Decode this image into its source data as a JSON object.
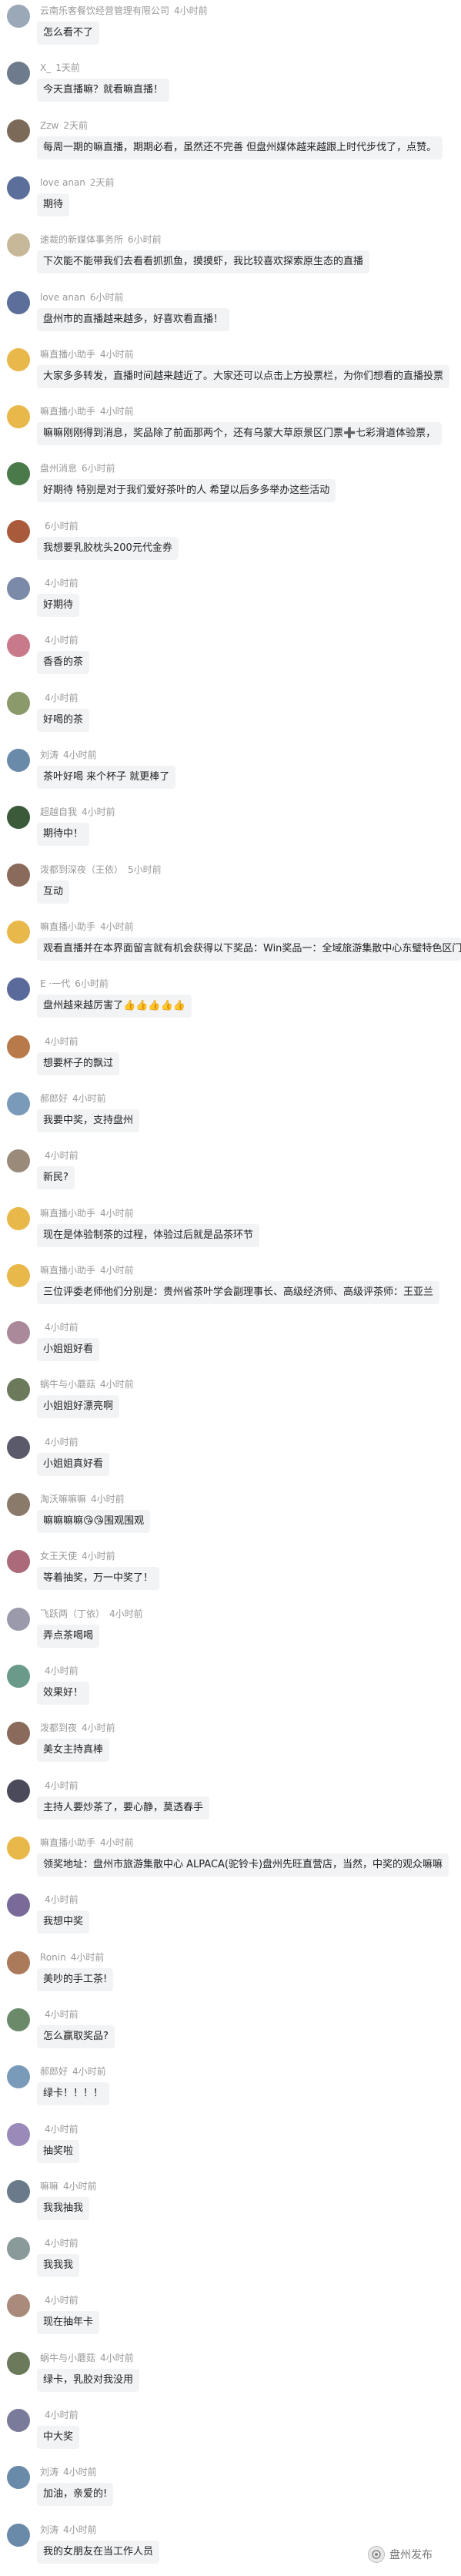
{
  "watermark": "盘州发布",
  "comments": [
    {
      "user": "云南乐客餐饮经营管理有限公司",
      "time": "4小时前",
      "text": "怎么看不了",
      "avatar_color": "#9aa8b8"
    },
    {
      "user": "X_",
      "time": "1天前",
      "text": "今天直播嘛？就看嘛直播！",
      "avatar_color": "#6d7b8c"
    },
    {
      "user": "Zzw",
      "time": "2天前",
      "text": "每周一期的嘛直播，期期必看，虽然还不完善 但盘州媒体越来越跟上时代步伐了，点赞。",
      "avatar_color": "#7b6a58"
    },
    {
      "user": "love anan",
      "time": "2天前",
      "text": "期待",
      "avatar_color": "#5b6f9a"
    },
    {
      "user": "速裁的新媒体事务所",
      "time": "6小时前",
      "text": "下次能不能带我们去看看抓抓鱼，摸摸虾，我比较喜欢探索原生态的直播",
      "avatar_color": "#c8b89a"
    },
    {
      "user": "love anan",
      "time": "6小时前",
      "text": "盘州市的直播越来越多，好喜欢看直播！",
      "avatar_color": "#5b6f9a"
    },
    {
      "user": "嘛直播小助手",
      "time": "4小时前",
      "text": "大家多多转发，直播时间越来越近了。大家还可以点击上方投票栏，为你们想看的直播投票",
      "avatar_color": "#e9b84a"
    },
    {
      "user": "嘛直播小助手",
      "time": "4小时前",
      "text": "嘛嘛刚刚得到消息，奖品除了前面那两个，还有乌蒙大草原景区门票➕七彩滑道体验票，",
      "avatar_color": "#e9b84a"
    },
    {
      "user": "盘州消息",
      "time": "6小时前",
      "text": "好期待 特别是对于我们爱好茶叶的人 希望以后多多举办这些活动",
      "avatar_color": "#4a7a4a"
    },
    {
      "user": "",
      "time": "6小时前",
      "text": "我想要乳胶枕头200元代金券",
      "avatar_color": "#a85a3a"
    },
    {
      "user": "",
      "time": "4小时前",
      "text": "好期待",
      "avatar_color": "#7a8aa8"
    },
    {
      "user": "",
      "time": "4小时前",
      "text": "香香的茶",
      "avatar_color": "#c87a8a"
    },
    {
      "user": "",
      "time": "4小时前",
      "text": "好喝的茶",
      "avatar_color": "#8a9a6a"
    },
    {
      "user": "刘涛",
      "time": "4小时前",
      "text": "茶叶好喝 来个杯子 就更棒了",
      "avatar_color": "#6a8aaa"
    },
    {
      "user": "超越自我",
      "time": "4小时前",
      "text": "期待中！",
      "avatar_color": "#3a5a3a"
    },
    {
      "user": "泼都到深夜（王依）",
      "time": "5小时前",
      "text": "互动",
      "avatar_color": "#8a6a5a"
    },
    {
      "user": "嘛直播小助手",
      "time": "4小时前",
      "text": "观看直播并在本界面留言就有机会获得以下奖品：Win奖品一：全域旅游集散中心东璧特色区门票＋七彩滑道体验票、杯子、雨伞等",
      "avatar_color": "#e9b84a"
    },
    {
      "user": "E ·一代",
      "time": "6小时前",
      "text": "盘州越来越厉害了👍👍👍👍👍",
      "avatar_color": "#5a6a9a"
    },
    {
      "user": "",
      "time": "4小时前",
      "text": "想要杯子的飘过",
      "avatar_color": "#b87a4a"
    },
    {
      "user": "郝郎好",
      "time": "4小时前",
      "text": "我要中奖，支持盘州",
      "avatar_color": "#7a9aba"
    },
    {
      "user": "",
      "time": "4小时前",
      "text": "新民?",
      "avatar_color": "#9a8a7a"
    },
    {
      "user": "嘛直播小助手",
      "time": "4小时前",
      "text": "现在是体验制茶的过程，体验过后就是品茶环节",
      "avatar_color": "#e9b84a"
    },
    {
      "user": "嘛直播小助手",
      "time": "4小时前",
      "text": "三位评委老师他们分别是：贵州省茶叶学会副理事长、高级经济师、高级评茶师：王亚兰",
      "avatar_color": "#e9b84a"
    },
    {
      "user": "",
      "time": "4小时前",
      "text": "小姐姐好看",
      "avatar_color": "#aa8a9a"
    },
    {
      "user": "蜗牛与小蘑菇",
      "time": "4小时前",
      "text": "小姐姐好漂亮啊",
      "avatar_color": "#6a7a5a"
    },
    {
      "user": "",
      "time": "4小时前",
      "text": "小姐姐真好看",
      "avatar_color": "#5a5a6a"
    },
    {
      "user": "淘沃嘛嘛嘛",
      "time": "4小时前",
      "text": "嘛嘛嘛嘛😘😘围观围观",
      "avatar_color": "#8a7a6a"
    },
    {
      "user": "女王天使",
      "time": "4小时前",
      "text": "等着抽奖，万一中奖了！",
      "avatar_color": "#aa6a7a"
    },
    {
      "user": "飞跃两（丁依）",
      "time": "4小时前",
      "text": "弄点茶喝喝",
      "avatar_color": "#9a9aaa"
    },
    {
      "user": "",
      "time": "4小时前",
      "text": "效果好！",
      "avatar_color": "#6a9a8a"
    },
    {
      "user": "泼都到夜",
      "time": "4小时前",
      "text": "美女主持真棒",
      "avatar_color": "#8a6a5a"
    },
    {
      "user": "",
      "time": "4小时前",
      "text": "主持人要炒茶了，要心静，莫透春手",
      "avatar_color": "#4a4a5a"
    },
    {
      "user": "嘛直播小助手",
      "time": "4小时前",
      "text": "领奖地址：盘州市旅游集散中心 ALPACA(驼铃卡)盘州先旺直营店，当然，中奖的观众嘛嘛",
      "avatar_color": "#e9b84a"
    },
    {
      "user": "",
      "time": "4小时前",
      "text": "我想中奖",
      "avatar_color": "#7a6a9a"
    },
    {
      "user": "Ronin",
      "time": "4小时前",
      "text": "美吵的手工茶!",
      "avatar_color": "#aa7a5a"
    },
    {
      "user": "",
      "time": "4小时前",
      "text": "怎么赢取奖品?",
      "avatar_color": "#6a8a6a"
    },
    {
      "user": "郝郎好",
      "time": "4小时前",
      "text": "绿卡！！！！",
      "avatar_color": "#7a9aba"
    },
    {
      "user": "",
      "time": "4小时前",
      "text": "抽奖啦",
      "avatar_color": "#9a8aba"
    },
    {
      "user": "嘛嘛",
      "time": "4小时前",
      "text": "我我抽我",
      "avatar_color": "#6a7a8a"
    },
    {
      "user": "",
      "time": "4小时前",
      "text": "我我我",
      "avatar_color": "#8a9a9a"
    },
    {
      "user": "",
      "time": "4小时前",
      "text": "现在抽年卡",
      "avatar_color": "#aa8a7a"
    },
    {
      "user": "蜗牛与小蘑菇",
      "time": "4小时前",
      "text": "绿卡，乳胶对我没用",
      "avatar_color": "#6a7a5a"
    },
    {
      "user": "",
      "time": "4小时前",
      "text": "中大奖",
      "avatar_color": "#7a7a9a"
    },
    {
      "user": "刘涛",
      "time": "4小时前",
      "text": "加油，亲爱的!",
      "avatar_color": "#6a8aaa"
    },
    {
      "user": "刘涛",
      "time": "4小时前",
      "text": "我的女朋友在当工作人员",
      "avatar_color": "#6a8aaa"
    }
  ]
}
